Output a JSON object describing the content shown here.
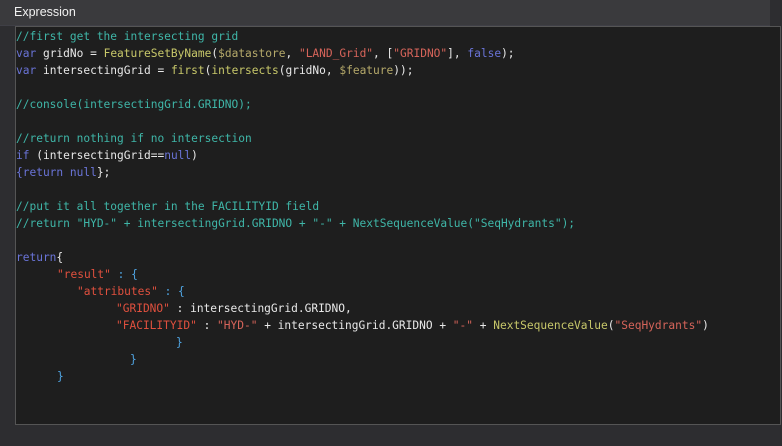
{
  "panel": {
    "title": "Expression"
  },
  "code": {
    "l1": "//first get the intersecting grid",
    "l2": {
      "kw": "var",
      "name": " gridNo = ",
      "fn": "FeatureSetByName",
      "p1": "(",
      "arg": "$datastore",
      "p2": ", ",
      "s1": "\"LAND_Grid\"",
      "p3": ", [",
      "s2": "\"GRIDNO\"",
      "p4": "], ",
      "kw2": "false",
      "p5": ");"
    },
    "l3": {
      "kw": "var",
      "name": " intersectingGrid = ",
      "fn1": "first",
      "p1": "(",
      "fn2": "intersects",
      "p2": "(gridNo, ",
      "arg": "$feature",
      "p3": "));"
    },
    "l5": "//console(intersectingGrid.GRIDNO);",
    "l7": "//return nothing if no intersection",
    "l8": {
      "kw": "if",
      "a": " (intersectingGrid==",
      "null": "null",
      "b": ")"
    },
    "l9": {
      "a": "{return ",
      "null": "null",
      "b": "};"
    },
    "l11": "//put it all together in the FACILITYID field",
    "l12": "//return \"HYD-\" + intersectingGrid.GRIDNO + \"-\" + NextSequenceValue(\"SeqHydrants\");",
    "l14": {
      "kw": "return",
      "b": "{"
    },
    "l15": {
      "key": "\"result\"",
      "b": " : {"
    },
    "l16": {
      "key": "\"attributes\"",
      "b": " : {"
    },
    "l17": {
      "key": "\"GRIDNO\"",
      "b": " : intersectingGrid.GRIDNO,"
    },
    "l18": {
      "key": "\"FACILITYID\"",
      "c": " : ",
      "s1": "\"HYD-\"",
      "d": " + intersectingGrid.GRIDNO + ",
      "s2": "\"-\"",
      "e": " + ",
      "fn": "NextSequenceValue",
      "f": "(",
      "s3": "\"SeqHydrants\"",
      "g": ")"
    },
    "l19": "}",
    "l20": "}",
    "l21": "}"
  },
  "colors": {
    "background": "#2d2d30",
    "editor_background": "#1e1e1e",
    "comment": "#3fb6a8",
    "keyword": "#569cd6",
    "function": "#c8c86a",
    "string": "#d6645a"
  }
}
